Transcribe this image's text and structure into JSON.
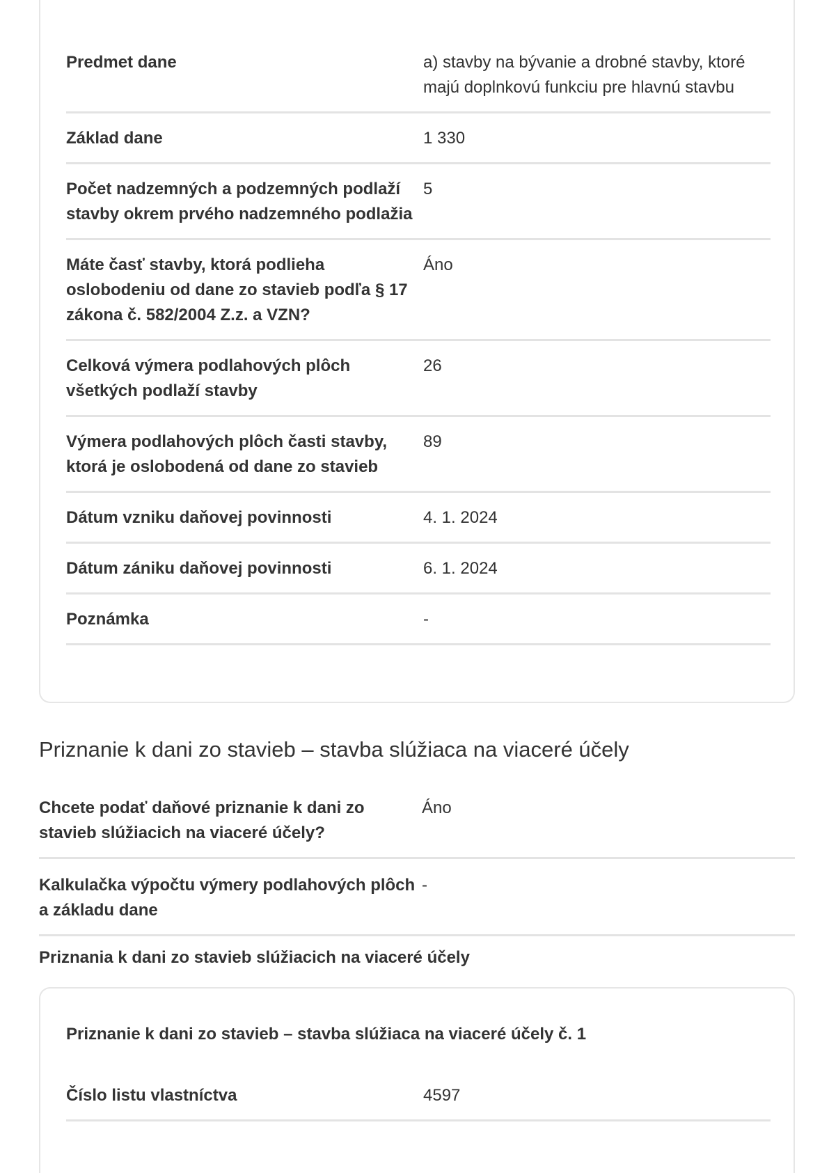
{
  "card1": {
    "rows": [
      {
        "label": "Predmet dane",
        "value": "a) stavby na bývanie a drobné stavby, ktoré majú doplnkovú funkciu pre hlavnú stavbu"
      },
      {
        "label": "Základ dane",
        "value": "1 330"
      },
      {
        "label": "Počet nadzemných a podzemných podlaží stavby okrem prvého nadzemného podlažia",
        "value": "5"
      },
      {
        "label": "Máte časť stavby, ktorá podlieha oslobodeniu od dane zo stavieb podľa § 17 zákona č. 582/2004 Z.z. a VZN?",
        "value": "Áno"
      },
      {
        "label": "Celková výmera podlahových plôch všetkých podlaží stavby",
        "value": "26"
      },
      {
        "label": "Výmera podlahových plôch časti stavby, ktorá je oslobodená od dane zo stavieb",
        "value": "89"
      },
      {
        "label": "Dátum vzniku daňovej povinnosti",
        "value": "4. 1. 2024"
      },
      {
        "label": "Dátum zániku daňovej povinnosti",
        "value": "6. 1. 2024"
      },
      {
        "label": "Poznámka",
        "value": "-"
      }
    ]
  },
  "section": {
    "title": "Priznanie k dani zo stavieb – stavba slúžiaca na viaceré účely",
    "rows": [
      {
        "label": "Chcete podať daňové priznanie k dani zo stavieb slúžiacich na viaceré účely?",
        "value": "Áno"
      },
      {
        "label": "Kalkulačka výpočtu výmery podlahových plôch a základu dane",
        "value": "-"
      }
    ],
    "subheading": "Priznania k dani zo stavieb slúžiacich na viaceré účely"
  },
  "card2": {
    "title": "Priznanie k dani zo stavieb – stavba slúžiaca na viaceré účely č. 1",
    "rows": [
      {
        "label": "Číslo listu vlastníctva",
        "value": "4597"
      }
    ]
  }
}
